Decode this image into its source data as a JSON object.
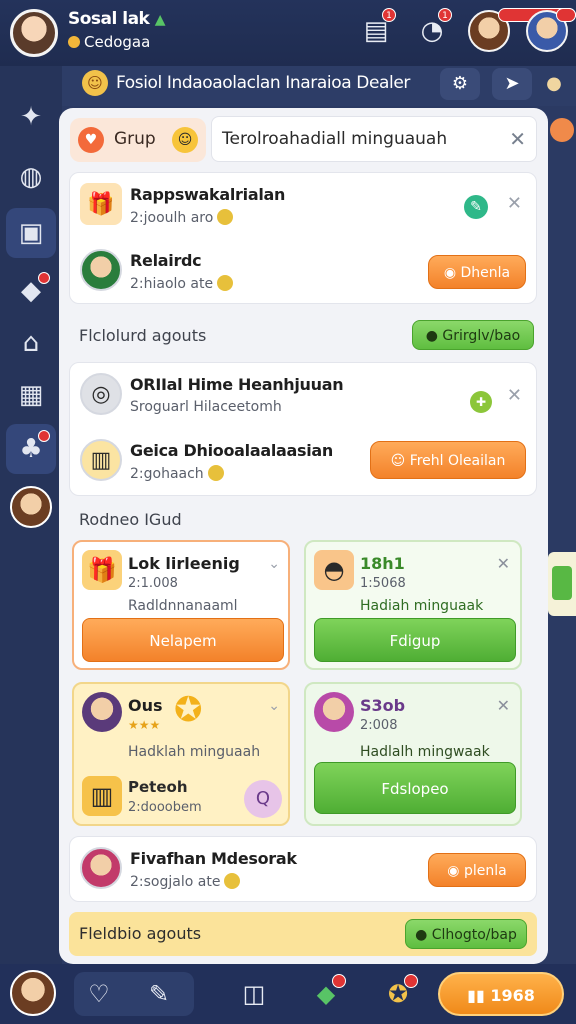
{
  "header": {
    "title": "Sosal lak",
    "subtitle": "Cedogaa",
    "icons": [
      {
        "name": "inbox-icon",
        "badge": "1"
      },
      {
        "name": "timer-icon",
        "badge": "1"
      }
    ]
  },
  "subbar": {
    "title": "Fosiol Indaoaolaclan Inaraioa Dealer",
    "icons": [
      "settings-icon",
      "share-icon",
      "bell-icon"
    ]
  },
  "panel": {
    "group_label": "Grup",
    "search_value": "Terolroahadiall minguauah",
    "list1": [
      {
        "name": "Rappswakalrialan",
        "meta": "2:jooulh aro"
      },
      {
        "name": "Relairdc",
        "meta": "2:hiaolo ate",
        "button": "Dhenla"
      }
    ],
    "section1": {
      "title": "Flclolurd agouts",
      "button": "Grirglv/bao"
    },
    "list2": [
      {
        "name": "ORIIal Hime Heanhjuuan",
        "meta": "Sroguarl Hilaceetomh"
      },
      {
        "name": "Geica Dhiooalaalaasian",
        "meta": "2:gohaach",
        "button": "Frehl Oleailan"
      }
    ],
    "section2": {
      "title": "Rodneo IGud"
    },
    "tiles": [
      {
        "name": "Lok lirleenig",
        "meta": "2:1.008",
        "desc": "Radldnnanaaml",
        "button": "Nelapem"
      },
      {
        "name": "18h1",
        "meta": "1:5068",
        "desc": "Hadiah minguaak",
        "button": "Fdigup"
      },
      {
        "name": "Ous",
        "desc": "Hadklah minguaah",
        "sub_name": "Peteoh",
        "sub_meta": "2:dooobem"
      },
      {
        "name": "S3ob",
        "meta": "2:008",
        "desc": "Hadlalh mingwaak",
        "button": "Fdslopeo"
      }
    ],
    "list3": [
      {
        "name": "Fivafhan Mdesorak",
        "meta": "2:sogjalo ate",
        "button": "plenla"
      }
    ],
    "section3": {
      "title": "Fleldbio agouts",
      "button": "Clhogto/bap"
    }
  },
  "bottom": {
    "coin_value": "1968"
  },
  "colors": {
    "background": "#2b3a63",
    "orange": "#f3822a",
    "green": "#4fae34",
    "badge": "#e03434"
  }
}
